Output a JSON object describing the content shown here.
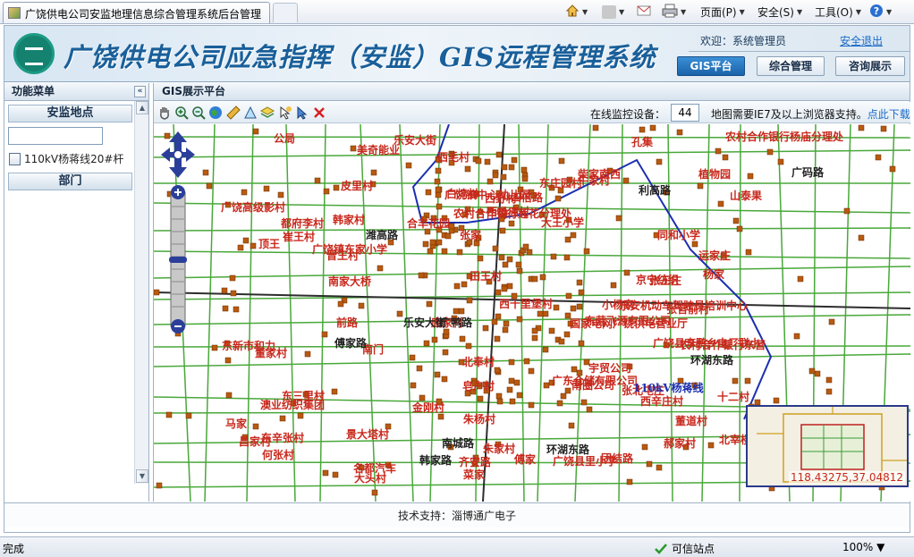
{
  "browser": {
    "tab_title": "广饶供电公司安监地理信息综合管理系统后台管理",
    "menu_page": "页面(P)",
    "menu_safety": "安全(S)",
    "menu_tools": "工具(O)",
    "status_done": "完成",
    "status_trusted": "可信站点",
    "zoom": "100%"
  },
  "header": {
    "title": "广饶供电公司应急指挥（安监）GIS远程管理系统",
    "welcome": "欢迎：系统管理员",
    "logout": "安全退出",
    "nav": [
      {
        "label": "GIS平台",
        "active": true
      },
      {
        "label": "综合管理",
        "active": false
      },
      {
        "label": "咨询展示",
        "active": false
      }
    ]
  },
  "sidebar": {
    "title": "功能菜单",
    "collapse": "«",
    "section1": "安监地点",
    "search_value": "",
    "item1": "110kV杨蒋线20#杆",
    "section2": "部门"
  },
  "main": {
    "title": "GIS展示平台",
    "monitor_label": "在线监控设备：",
    "monitor_count": "44",
    "ie_note": "地图需要IE7及以上浏览器支持。",
    "ie_link": "点此下载"
  },
  "map": {
    "places": [
      "崔王村",
      "广东仓储有限公司",
      "张北屯庄",
      "牛家村",
      "张官前村",
      "京宁纺织",
      "四倍路",
      "同和小学",
      "东营飞源有限公司",
      "澳业纺织集团",
      "杨家",
      "张王庄",
      "大王小学",
      "白坞村",
      "田王村",
      "齐安路",
      "团结路",
      "马家",
      "山泰果",
      "公局",
      "孔集",
      "张家",
      "十二村",
      "顶王",
      "南门",
      "西十里堡村",
      "美奇能业",
      "乐安机动车驾驶员培训中心",
      "前路",
      "国家电网广饶供电营业厅",
      "韩家村",
      "合丰花园",
      "东庄园村",
      "广饶高级影村",
      "名都汽车",
      "广饶镇中心幼儿园",
      "皂户村",
      "大头村",
      "菜家",
      "植物园",
      "宇贸公司",
      "昌家村",
      "南圈公司",
      "运家庄",
      "西杨庙村",
      "东辛张村",
      "晋王村",
      "广饶镇东家小学",
      "朱家村",
      "农村合作银行杨庙分理处",
      "唐家村",
      "皮里村",
      "北奉村",
      "西野村",
      "广饶县里小学",
      "董家村",
      "广饶县李鹏乡电厂联小",
      "东新市和力",
      "都府李村",
      "柴家南西",
      "小杨家",
      "北宰楼村",
      "西毛村",
      "何张村",
      "董道村",
      "金刚村",
      "农村合作银行莲花分理处",
      "南家大桥",
      "农村合作银行东营",
      "东三里村",
      "乐安大街",
      "景大塔村",
      "朱杨村",
      "傅家",
      "郝家村",
      "西辛庄村"
    ],
    "roads": [
      "广鸭路",
      "广码路",
      "环湖东路",
      "利高路",
      "傅家路",
      "环湖东路",
      "韩家路",
      "南城路",
      "潍高路",
      "乐安大街"
    ],
    "line_label": "110kV杨蒋线",
    "coord": "118.43275,37.04812"
  },
  "footer": {
    "text": "技术支持：淄博通广电子"
  }
}
